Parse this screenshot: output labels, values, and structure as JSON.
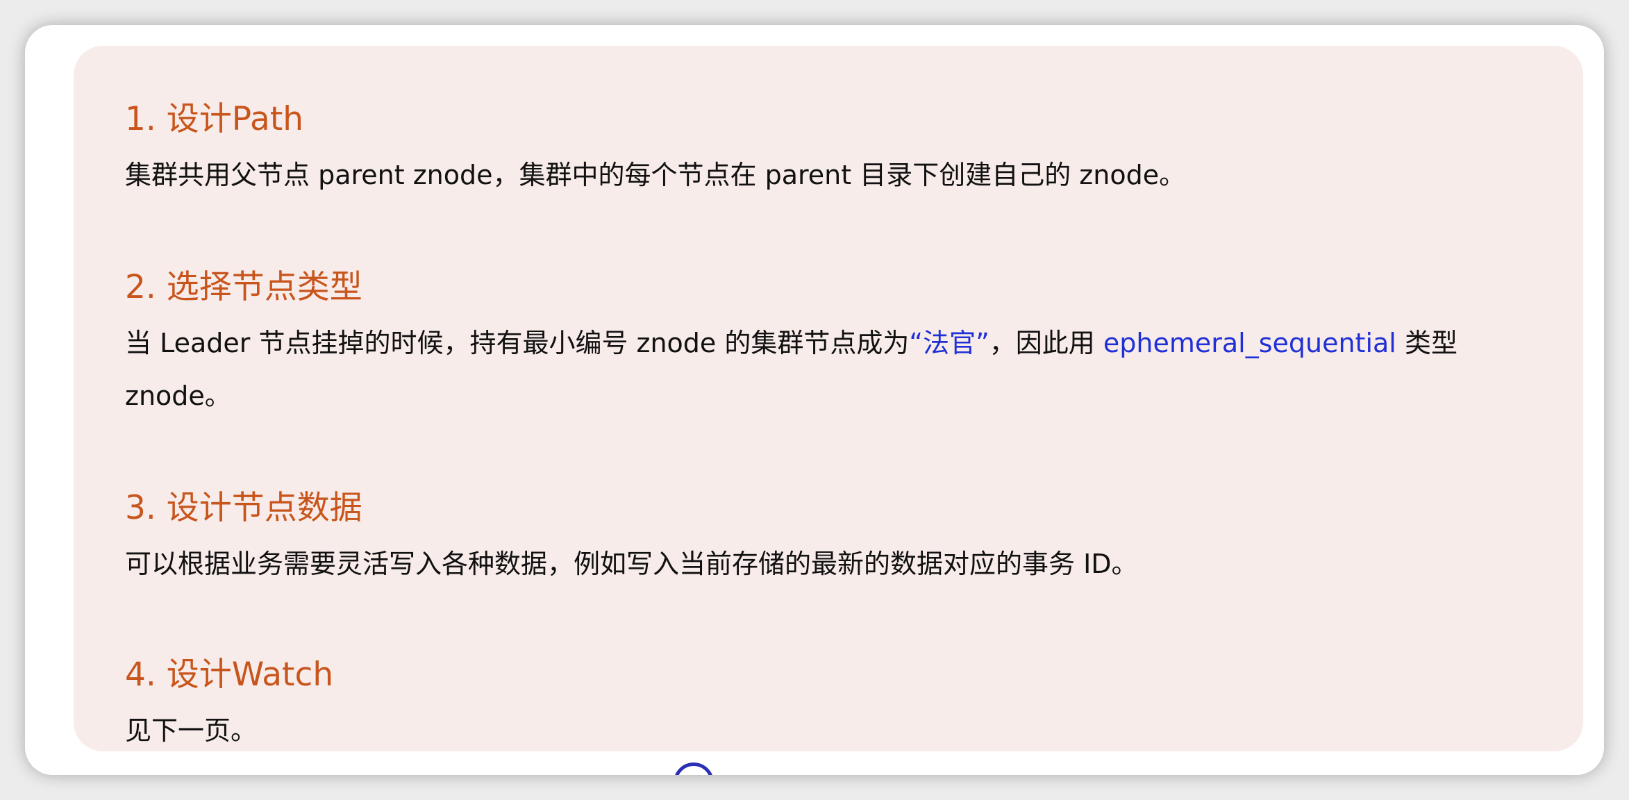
{
  "sections": [
    {
      "heading": "1. 设计Path",
      "body_text": "集群共用父节点 parent znode，集群中的每个节点在 parent 目录下创建自己的 znode。"
    },
    {
      "heading": "2. 选择节点类型",
      "body_part1": "当 Leader 节点挂掉的时候，持有最小编号 znode 的集群节点成为",
      "body_highlight1": "“法官”",
      "body_part2": "，因此用",
      "body_highlight2": "ephemeral_sequential",
      "body_part3": "类型 znode。"
    },
    {
      "heading": "3. 设计节点数据",
      "body_text": "可以根据业务需要灵活写入各种数据，例如写入当前存储的最新的数据对应的事务 ID。"
    },
    {
      "heading": "4. 设计Watch",
      "body_text": "见下一页。"
    }
  ],
  "colors": {
    "heading": "#c8551c",
    "highlight": "#1f30d6",
    "card_background": "#f8ecea"
  }
}
